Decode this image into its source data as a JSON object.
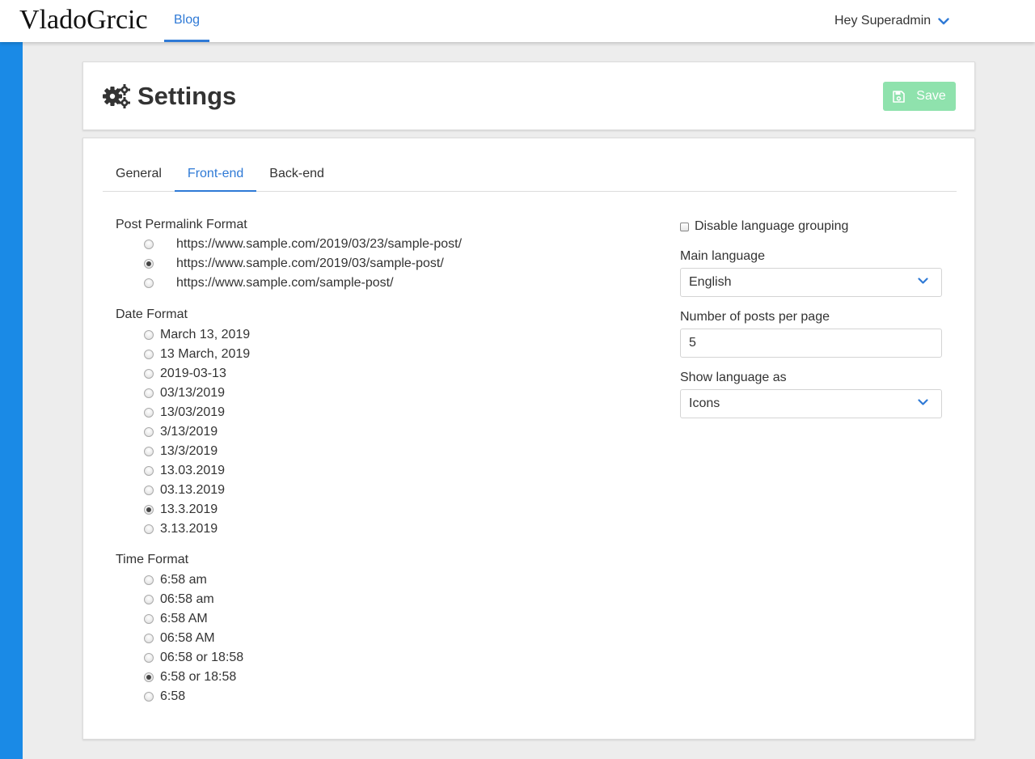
{
  "navbar": {
    "brand": "VladoGrcic",
    "blog_link": "Blog",
    "user_greeting": "Hey Superadmin"
  },
  "colors": {
    "accent": "#1a8ae6",
    "link": "#2f7ad6",
    "save_button": "#8fe2ad",
    "background": "#ededed"
  },
  "header": {
    "title": "Settings",
    "title_icon": "gears-icon",
    "save_label": "Save",
    "save_icon": "floppy-disk-icon"
  },
  "tabs": [
    {
      "label": "General",
      "active": false
    },
    {
      "label": "Front-end",
      "active": true
    },
    {
      "label": "Back-end",
      "active": false
    }
  ],
  "permalink": {
    "label": "Post Permalink Format",
    "options": [
      {
        "label": "https://www.sample.com/2019/03/23/sample-post/",
        "checked": false
      },
      {
        "label": "https://www.sample.com/2019/03/sample-post/",
        "checked": true
      },
      {
        "label": "https://www.sample.com/sample-post/",
        "checked": false
      }
    ]
  },
  "date_format": {
    "label": "Date Format",
    "options": [
      {
        "label": "March 13, 2019",
        "checked": false
      },
      {
        "label": "13 March, 2019",
        "checked": false
      },
      {
        "label": "2019-03-13",
        "checked": false
      },
      {
        "label": "03/13/2019",
        "checked": false
      },
      {
        "label": "13/03/2019",
        "checked": false
      },
      {
        "label": "3/13/2019",
        "checked": false
      },
      {
        "label": "13/3/2019",
        "checked": false
      },
      {
        "label": "13.03.2019",
        "checked": false
      },
      {
        "label": "03.13.2019",
        "checked": false
      },
      {
        "label": "13.3.2019",
        "checked": true
      },
      {
        "label": "3.13.2019",
        "checked": false
      }
    ]
  },
  "time_format": {
    "label": "Time Format",
    "options": [
      {
        "label": "6:58 am",
        "checked": false
      },
      {
        "label": "06:58 am",
        "checked": false
      },
      {
        "label": "6:58 AM",
        "checked": false
      },
      {
        "label": "06:58 AM",
        "checked": false
      },
      {
        "label": "06:58 or 18:58",
        "checked": false
      },
      {
        "label": "6:58 or 18:58",
        "checked": true
      },
      {
        "label": "6:58",
        "checked": false
      }
    ]
  },
  "right": {
    "disable_grouping_label": "Disable language grouping",
    "disable_grouping_checked": false,
    "main_language_label": "Main language",
    "main_language_value": "English",
    "posts_per_page_label": "Number of posts per page",
    "posts_per_page_value": "5",
    "show_language_label": "Show language as",
    "show_language_value": "Icons"
  }
}
